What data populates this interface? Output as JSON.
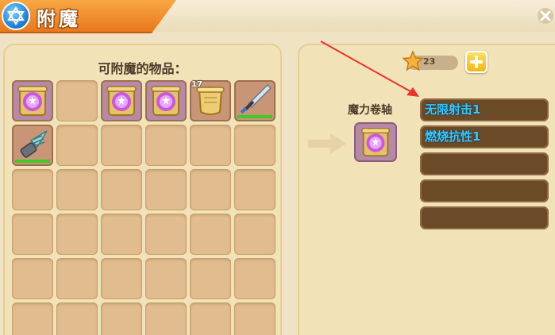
{
  "header": {
    "title": "附魔",
    "emblem_icon": "hexagram-star-icon",
    "close_icon": "close-icon"
  },
  "inventory": {
    "title": "可附魔的物品：",
    "slots": [
      {
        "item": "magic-scroll-icon",
        "selected": true
      },
      {
        "item": null
      },
      {
        "item": "magic-scroll-icon",
        "selected": true
      },
      {
        "item": "magic-scroll-icon",
        "selected": true
      },
      {
        "item": "plain-scroll-icon",
        "count": "17"
      },
      {
        "item": "sword-icon",
        "durability": 1.0
      },
      {
        "item": "drill-icon",
        "durability": 1.0
      },
      {
        "item": null
      },
      {
        "item": null
      },
      {
        "item": null
      },
      {
        "item": null
      },
      {
        "item": null
      },
      {
        "item": null
      },
      {
        "item": null
      },
      {
        "item": null
      },
      {
        "item": null
      },
      {
        "item": null
      },
      {
        "item": null
      },
      {
        "item": null
      },
      {
        "item": null
      },
      {
        "item": null
      },
      {
        "item": null
      },
      {
        "item": null
      },
      {
        "item": null
      },
      {
        "item": null
      },
      {
        "item": null
      },
      {
        "item": null
      },
      {
        "item": null
      },
      {
        "item": null
      },
      {
        "item": null
      },
      {
        "item": null
      },
      {
        "item": null
      },
      {
        "item": null
      },
      {
        "item": null
      },
      {
        "item": null
      },
      {
        "item": null
      }
    ]
  },
  "currency": {
    "icon": "star-icon",
    "value": "23",
    "add_icon": "plus-icon"
  },
  "enchant": {
    "item_label": "魔力卷轴",
    "item_icon": "magic-scroll-icon",
    "arrow_icon": "arrow-right-icon",
    "options": [
      "无限射击1",
      "燃烧抗性1",
      "",
      "",
      ""
    ]
  },
  "colors": {
    "header_accent": "#f08a2a",
    "enchant_text": "#35c8ff",
    "durability": "#3ecb2a"
  }
}
